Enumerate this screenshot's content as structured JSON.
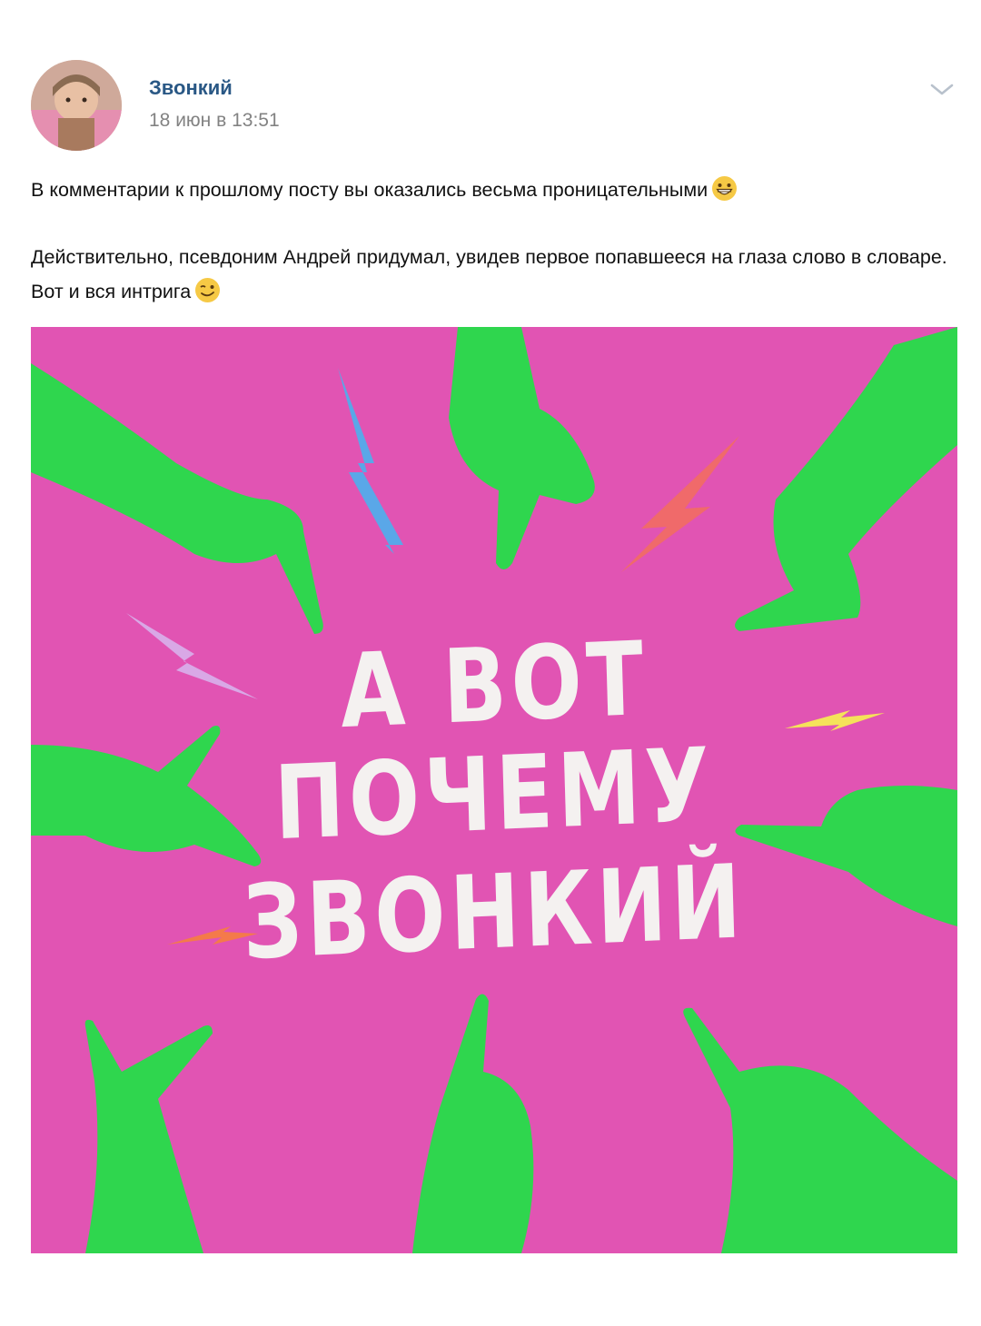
{
  "post": {
    "author": "Звонкий",
    "date": "18 июн в 13:51",
    "text_line1": "В комментарии к прошлому посту вы оказались весьма проницательными",
    "text_para2": "Действительно, псевдоним Андрей придумал, увидев первое попавшееся на глаза слово в словаре. Вот и вся интрига",
    "emoji1": "grinning-face-emoji",
    "emoji2": "winking-face-emoji",
    "menu_icon": "chevron-down-icon"
  },
  "image": {
    "line1": "А ВОТ",
    "line2": "ПОЧЕМУ",
    "line3": "ЗВОНКИЙ",
    "colors": {
      "background": "#e154b3",
      "hands": "#2fd64e",
      "text": "#f4f1f0",
      "bolt_blue": "#5aa7e8",
      "bolt_red": "#f06a6a",
      "bolt_lilac": "#d9a8e6",
      "bolt_yellow": "#f5e25a",
      "bolt_orange": "#f47a4a"
    }
  }
}
